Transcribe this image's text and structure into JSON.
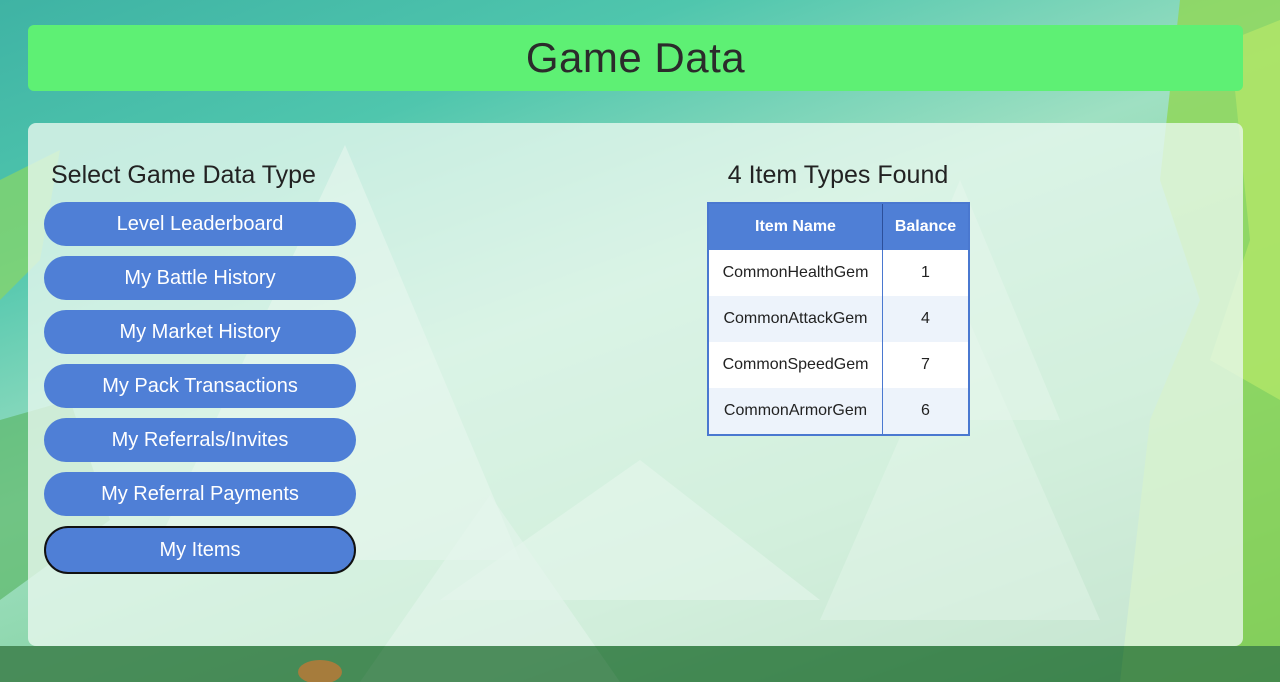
{
  "header": {
    "title": "Game Data"
  },
  "selector": {
    "title": "Select Game Data Type",
    "buttons": [
      {
        "label": "Level Leaderboard",
        "active": false
      },
      {
        "label": "My Battle History",
        "active": false
      },
      {
        "label": "My Market History",
        "active": false
      },
      {
        "label": "My Pack Transactions",
        "active": false
      },
      {
        "label": "My Referrals/Invites",
        "active": false
      },
      {
        "label": "My Referral Payments",
        "active": false
      },
      {
        "label": "My Items",
        "active": true
      }
    ]
  },
  "results": {
    "title": "4 Item Types Found",
    "columns": [
      "Item Name",
      "Balance"
    ],
    "rows": [
      {
        "name": "CommonHealthGem",
        "balance": "1"
      },
      {
        "name": "CommonAttackGem",
        "balance": "4"
      },
      {
        "name": "CommonSpeedGem",
        "balance": "7"
      },
      {
        "name": "CommonArmorGem",
        "balance": "6"
      }
    ]
  },
  "colors": {
    "header_bg": "#5ef074",
    "button_bg": "#4f7fd6",
    "table_header_bg": "#4f7fd6",
    "table_border": "#4a78d0"
  }
}
